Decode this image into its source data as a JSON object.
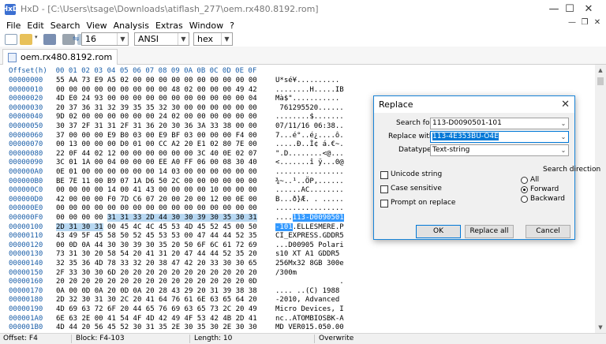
{
  "window": {
    "title": "HxD - [C:\\Users\\tsage\\Downloads\\atiflash_277\\oem.rx480.8192.rom]",
    "app_icon": "HxD",
    "minimize_icon": "minimize-icon",
    "maximize_icon": "maximize-icon",
    "close_icon": "close-icon"
  },
  "menu": [
    "File",
    "Edit",
    "Search",
    "View",
    "Analysis",
    "Extras",
    "Window",
    "?"
  ],
  "toolbar": {
    "columns": "16",
    "charset": "ANSI",
    "offset_base": "hex"
  },
  "tab": {
    "label": "oem.rx480.8192.rom"
  },
  "hex": {
    "header": "Offset(h)  00 01 02 03 04 05 06 07 08 09 0A 0B 0C 0D 0E 0F",
    "rows": [
      {
        "off": "00000000",
        "hex": "55 AA 73 E9 A5 02 00 00 00 00 00 00 00 00 00 00",
        "ascii": "U*sé¥.........."
      },
      {
        "off": "00000010",
        "hex": "00 00 00 00 00 00 00 00 00 48 02 00 00 00 49 42",
        "ascii": "........H.....IB"
      },
      {
        "off": "00000020",
        "hex": "4D E0 24 93 00 00 00 00 00 00 00 00 00 00 00 04",
        "ascii": "Mà$\"..........."
      },
      {
        "off": "00000030",
        "hex": "20 37 36 31 32 39 35 35 32 30 00 00 00 00 00 00",
        "ascii": " 761295520......"
      },
      {
        "off": "00000040",
        "hex": "9D 02 00 00 00 00 00 00 24 02 00 00 00 00 00 00",
        "ascii": "........$......."
      },
      {
        "off": "00000050",
        "hex": "30 37 2F 31 31 2F 31 36 20 30 36 3A 33 38 00 00",
        "ascii": "07/11/16 06:38.."
      },
      {
        "off": "00000060",
        "hex": "37 00 00 00 E9 B0 03 00 E9 BF 03 00 00 00 F4 00",
        "ascii": "7...é°..é¿....ô."
      },
      {
        "off": "00000070",
        "hex": "00 13 00 00 00 D0 01 00 CC A2 20 E1 02 80 7E 00",
        "ascii": ".....Ð..Ì¢ á.€~."
      },
      {
        "off": "00000080",
        "hex": "22 0F 44 02 12 00 00 00 00 00 00 3C 40 0E 02 07",
        "ascii": "\".D........<@..."
      },
      {
        "off": "00000090",
        "hex": "3C 01 1A 00 04 00 00 00 EE A0 FF 06 00 08 30 40",
        "ascii": "<.......î ÿ...0@"
      },
      {
        "off": "000000A0",
        "hex": "0E 01 00 00 00 00 00 00 14 03 00 00 00 00 00 00",
        "ascii": "................"
      },
      {
        "off": "000000B0",
        "hex": "BE 7E 11 00 B9 07 1A D6 50 2C 00 00 00 00 00 00",
        "ascii": "¾~..¹..ÖP,......"
      },
      {
        "off": "000000C0",
        "hex": "00 00 00 00 14 00 41 43 00 00 00 00 10 00 00 00",
        "ascii": "......AC........"
      },
      {
        "off": "000000D0",
        "hex": "42 00 00 00 F0 7D C6 07 20 00 20 00 12 00 0E 00",
        "ascii": "B...ð}Æ. . ....."
      },
      {
        "off": "000000E0",
        "hex": "00 00 00 00 00 00 00 00 00 00 00 00 00 00 00 00",
        "ascii": "................"
      },
      {
        "off": "000000F0",
        "hex_pre": "00 00 00 00 ",
        "hex_sel": "31 31 33 2D 44 30 30 39 30 35 30 31",
        "hex_post": "",
        "ascii_pre": "....",
        "ascii_sel": "113-D0090501",
        "ascii_post": ""
      },
      {
        "off": "00000100",
        "hex_pre": "",
        "hex_sel": "2D 31 30 31",
        "hex_post": " 00 45 4C 4C 45 53 4D 45 52 45 00 50",
        "ascii_pre": "",
        "ascii_sel": "-101",
        "ascii_post": ".ELLESMERE.P"
      },
      {
        "off": "00000110",
        "hex": "43 49 5F 45 58 50 52 45 53 53 00 47 44 44 52 35",
        "ascii": "CI_EXPRESS.GDDR5"
      },
      {
        "off": "00000120",
        "hex": "00 0D 0A 44 30 30 39 30 35 20 50 6F 6C 61 72 69",
        "ascii": "...D00905 Polari"
      },
      {
        "off": "00000130",
        "hex": "73 31 30 20 58 54 20 41 31 20 47 44 44 52 35 20",
        "ascii": "s10 XT A1 GDDR5 "
      },
      {
        "off": "00000140",
        "hex": "32 35 36 4D 78 33 32 20 38 47 42 20 33 30 30 65",
        "ascii": "256Mx32 8GB 300e"
      },
      {
        "off": "00000150",
        "hex": "2F 33 30 30 6D 20 20 20 20 20 20 20 20 20 20 20",
        "ascii": "/300m           "
      },
      {
        "off": "00000160",
        "hex": "20 20 20 20 20 20 20 20 20 20 20 20 20 20 20 0D",
        "ascii": "               ."
      },
      {
        "off": "00000170",
        "hex": "0A 00 0D 0A 20 0D 0A 20 28 43 29 20 31 39 38 38",
        "ascii": ".... ..(C) 1988"
      },
      {
        "off": "00000180",
        "hex": "2D 32 30 31 30 2C 20 41 64 76 61 6E 63 65 64 20",
        "ascii": "-2010, Advanced "
      },
      {
        "off": "00000190",
        "hex": "4D 69 63 72 6F 20 44 65 76 69 63 65 73 2C 20 49",
        "ascii": "Micro Devices, I"
      },
      {
        "off": "000001A0",
        "hex": "6E 63 2E 00 41 54 4F 4D 42 49 4F 53 42 4B 2D 41",
        "ascii": "nc..ATOMBIOSBK-A"
      },
      {
        "off": "000001B0",
        "hex": "4D 44 20 56 45 52 30 31 35 2E 30 35 30 2E 30 30",
        "ascii": "MD VER015.050.00"
      }
    ]
  },
  "status": {
    "offset": "Offset: F4",
    "block": "Block: F4-103",
    "length": "Length: 10",
    "mode": "Overwrite"
  },
  "dialog": {
    "title": "Replace",
    "search_label": "Search for:",
    "search_value": "113-D0090501-101",
    "replace_label": "Replace with:",
    "replace_value": "113-4E353BU-O4E",
    "datatype_label": "Datatype:",
    "datatype_value": "Text-string",
    "unicode_label": "Unicode string",
    "case_label": "Case sensitive",
    "prompt_label": "Prompt on replace",
    "direction_label": "Search direction",
    "dir_all": "All",
    "dir_forward": "Forward",
    "dir_backward": "Backward",
    "ok": "OK",
    "replace_all": "Replace all",
    "cancel": "Cancel"
  }
}
